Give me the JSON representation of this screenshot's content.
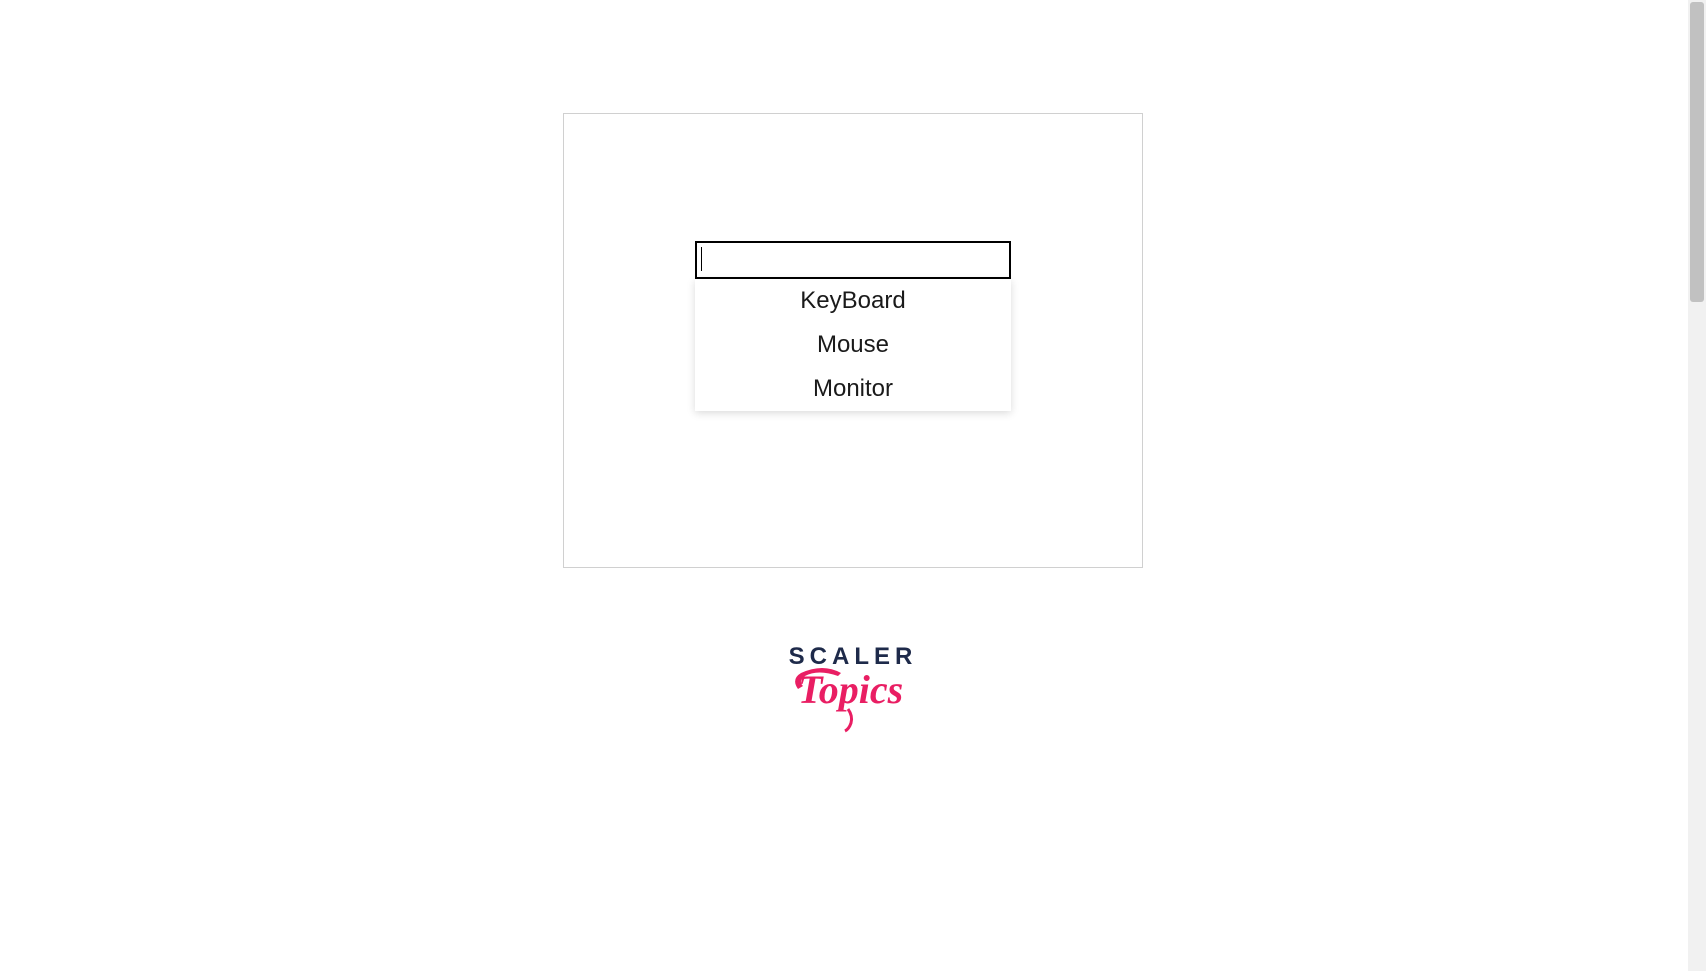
{
  "autocomplete": {
    "input_value": "",
    "options": [
      {
        "label": "KeyBoard"
      },
      {
        "label": "Mouse"
      },
      {
        "label": "Monitor"
      }
    ]
  },
  "logo": {
    "line1": "SCALER",
    "line2": "Topics"
  }
}
